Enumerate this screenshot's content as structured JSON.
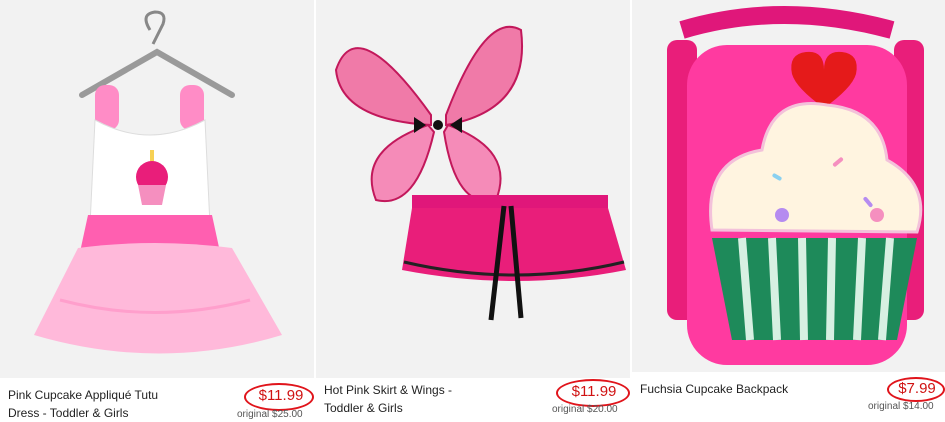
{
  "products": [
    {
      "name_line1": "Pink Cupcake Appliqué Tutu",
      "name_line2": "Dress - Toddler & Girls",
      "price": "$11.99",
      "original": "original $25.00"
    },
    {
      "name_line1": "Hot Pink Skirt & Wings -",
      "name_line2": "Toddler & Girls",
      "price": "$11.99",
      "original": "original $20.00"
    },
    {
      "name_line1": "Fuchsia Cupcake Backpack",
      "name_line2": "",
      "price": "$7.99",
      "original": "original $14.00"
    }
  ],
  "colors": {
    "price_red": "#d01212",
    "highlight_ring": "#e0141b",
    "pink": "#ff69b4",
    "fuchsia": "#e0177a"
  }
}
